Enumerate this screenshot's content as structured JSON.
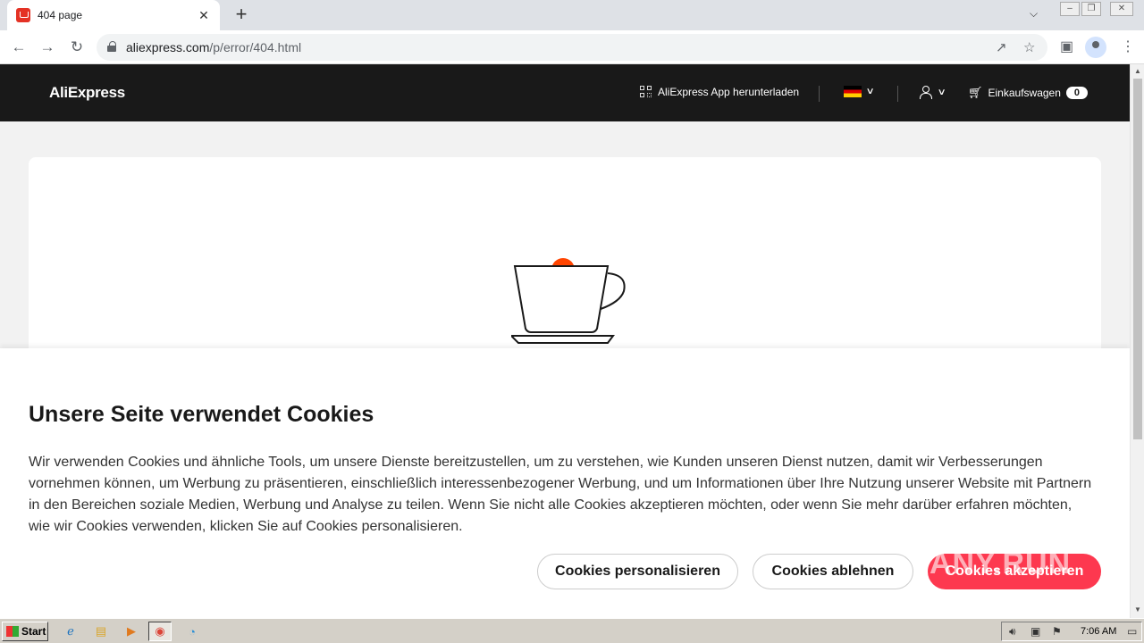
{
  "browser": {
    "tab_title": "404 page",
    "tab_close": "✕",
    "new_tab": "+",
    "url_domain": "aliexpress.com",
    "url_path": "/p/error/404.html"
  },
  "header": {
    "logo": "AliExpress",
    "app_download": "AliExpress App herunterladen",
    "cart_label": "Einkaufswagen",
    "cart_count": "0"
  },
  "cookie_banner": {
    "title": "Unsere Seite verwendet Cookies",
    "text": "Wir verwenden Cookies und ähnliche Tools, um unsere Dienste bereitzustellen, um zu verstehen, wie Kunden unseren Dienst nutzen, damit wir Verbesserungen vornehmen können, um Werbung zu präsentieren, einschließlich interessenbezogener Werbung, und um Informationen über Ihre Nutzung unserer Website mit Partnern in den Bereichen soziale Medien, Werbung und Analyse zu teilen. Wenn Sie nicht alle Cookies akzeptieren möchten, oder wenn Sie mehr darüber erfahren möchten, wie wir Cookies verwenden, klicken Sie auf Cookies personalisieren.",
    "btn_personalize": "Cookies personalisieren",
    "btn_reject": "Cookies ablehnen",
    "btn_accept": "Cookies akzeptieren",
    "watermark": "ANY.RUN"
  },
  "taskbar": {
    "start": "Start",
    "clock": "7:06 AM"
  },
  "colors": {
    "accent": "#fd384f",
    "header_bg": "#191919",
    "cup_dot": "#ff4400"
  }
}
